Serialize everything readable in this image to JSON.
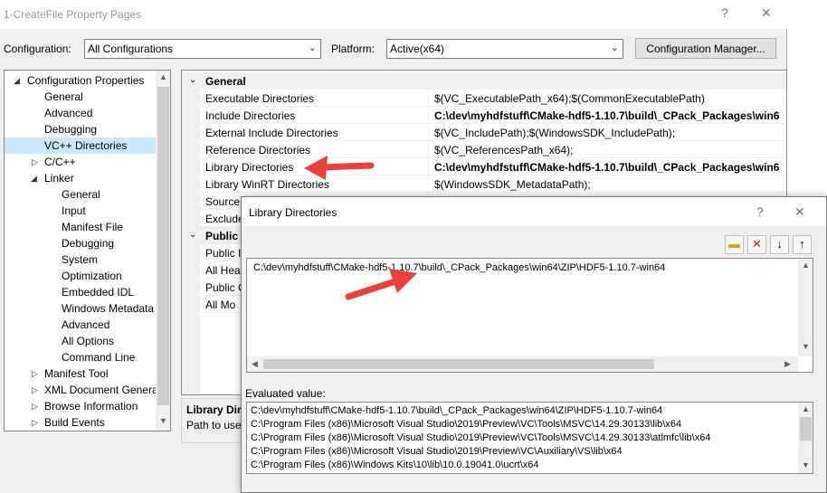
{
  "window": {
    "title": "1-CreateFile Property Pages",
    "help_glyph": "?",
    "close_glyph": "✕"
  },
  "toolbar": {
    "configuration_label": "Configuration:",
    "configuration_value": "All Configurations",
    "platform_label": "Platform:",
    "platform_value": "Active(x64)",
    "config_manager_label": "Configuration Manager..."
  },
  "tree": {
    "items": [
      {
        "label": "Configuration Properties"
      },
      {
        "label": "General"
      },
      {
        "label": "Advanced"
      },
      {
        "label": "Debugging"
      },
      {
        "label": "VC++ Directories"
      },
      {
        "label": "C/C++"
      },
      {
        "label": "Linker"
      },
      {
        "label": "General"
      },
      {
        "label": "Input"
      },
      {
        "label": "Manifest File"
      },
      {
        "label": "Debugging"
      },
      {
        "label": "System"
      },
      {
        "label": "Optimization"
      },
      {
        "label": "Embedded IDL"
      },
      {
        "label": "Windows Metadata"
      },
      {
        "label": "Advanced"
      },
      {
        "label": "All Options"
      },
      {
        "label": "Command Line"
      },
      {
        "label": "Manifest Tool"
      },
      {
        "label": "XML Document Genera"
      },
      {
        "label": "Browse Information"
      },
      {
        "label": "Build Events"
      }
    ]
  },
  "grid": {
    "general_label": "General",
    "public_label": "Public P",
    "rows": [
      {
        "name": "Executable Directories",
        "value": "$(VC_ExecutablePath_x64);$(CommonExecutablePath)"
      },
      {
        "name": "Include Directories",
        "value": "C:\\dev\\myhdfstuff\\CMake-hdf5-1.10.7\\build\\_CPack_Packages\\win6"
      },
      {
        "name": "External Include Directories",
        "value": "$(VC_IncludePath);$(WindowsSDK_IncludePath);"
      },
      {
        "name": "Reference Directories",
        "value": "$(VC_ReferencesPath_x64);"
      },
      {
        "name": "Library Directories",
        "value": "C:\\dev\\myhdfstuff\\CMake-hdf5-1.10.7\\build\\_CPack_Packages\\win6"
      },
      {
        "name": "Library WinRT Directories",
        "value": "$(WindowsSDK_MetadataPath);"
      },
      {
        "name": "Source D",
        "value": ""
      },
      {
        "name": "Exclude",
        "value": ""
      }
    ],
    "public_rows": [
      {
        "name": "Public I"
      },
      {
        "name": "All Hea"
      },
      {
        "name": "Public C"
      },
      {
        "name": "All Mo"
      }
    ]
  },
  "description": {
    "title": "Library Dir",
    "text": "Path to use"
  },
  "dialog": {
    "title": "Library Directories",
    "help_glyph": "?",
    "close_glyph": "✕",
    "entry": "C:\\dev\\myhdfstuff\\CMake-hdf5-1.10.7\\build\\_CPack_Packages\\win64\\ZIP\\HDF5-1.10.7-win64",
    "evaluated_label": "Evaluated value:",
    "evaluated_lines": [
      "C:\\dev\\myhdfstuff\\CMake-hdf5-1.10.7\\build\\_CPack_Packages\\win64\\ZIP\\HDF5-1.10.7-win64",
      "C:\\Program Files (x86)\\Microsoft Visual Studio\\2019\\Preview\\VC\\Tools\\MSVC\\14.29.30133\\lib\\x64",
      "C:\\Program Files (x86)\\Microsoft Visual Studio\\2019\\Preview\\VC\\Tools\\MSVC\\14.29.30133\\atlmfc\\lib\\x64",
      "C:\\Program Files (x86)\\Microsoft Visual Studio\\2019\\Preview\\VC\\Auxiliary\\VS\\lib\\x64",
      "C:\\Program Files (x86)\\Windows Kits\\10\\lib\\10.0.19041.0\\ucrt\\x64"
    ]
  },
  "colors": {
    "annotation_arrow": "#e8413c",
    "selection": "#cce8ff"
  }
}
